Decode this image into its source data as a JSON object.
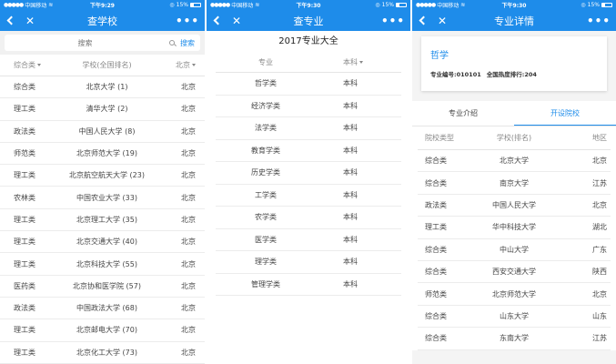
{
  "status": {
    "carrier": "中国移动",
    "time_left": "下午9:29",
    "time_mid": "下午9:30",
    "time_right": "下午9:30",
    "battery": "15%"
  },
  "screen1": {
    "title": "查学校",
    "search_placeholder": "搜索",
    "search_button": "搜索",
    "headers": {
      "type": "综合类",
      "school": "学校(全国排名)",
      "region": "北京"
    },
    "rows": [
      {
        "type": "综合类",
        "school": "北京大学 (1)",
        "region": "北京"
      },
      {
        "type": "理工类",
        "school": "清华大学 (2)",
        "region": "北京"
      },
      {
        "type": "政法类",
        "school": "中国人民大学 (8)",
        "region": "北京"
      },
      {
        "type": "师范类",
        "school": "北京师范大学 (19)",
        "region": "北京"
      },
      {
        "type": "理工类",
        "school": "北京航空航天大学 (23)",
        "region": "北京"
      },
      {
        "type": "农林类",
        "school": "中国农业大学 (33)",
        "region": "北京"
      },
      {
        "type": "理工类",
        "school": "北京理工大学 (35)",
        "region": "北京"
      },
      {
        "type": "理工类",
        "school": "北京交通大学 (40)",
        "region": "北京"
      },
      {
        "type": "理工类",
        "school": "北京科技大学 (55)",
        "region": "北京"
      },
      {
        "type": "医药类",
        "school": "北京协和医学院 (57)",
        "region": "北京"
      },
      {
        "type": "政法类",
        "school": "中国政法大学 (68)",
        "region": "北京"
      },
      {
        "type": "理工类",
        "school": "北京邮电大学 (70)",
        "region": "北京"
      },
      {
        "type": "理工类",
        "school": "北京化工大学 (73)",
        "region": "北京"
      }
    ]
  },
  "screen2": {
    "title": "查专业",
    "heading": "2017专业大全",
    "headers": {
      "major": "专业",
      "level": "本科"
    },
    "rows": [
      {
        "major": "哲学类",
        "level": "本科"
      },
      {
        "major": "经济学类",
        "level": "本科"
      },
      {
        "major": "法学类",
        "level": "本科"
      },
      {
        "major": "教育学类",
        "level": "本科"
      },
      {
        "major": "历史学类",
        "level": "本科"
      },
      {
        "major": "工学类",
        "level": "本科"
      },
      {
        "major": "农学类",
        "level": "本科"
      },
      {
        "major": "医学类",
        "level": "本科"
      },
      {
        "major": "理学类",
        "level": "本科"
      },
      {
        "major": "管理学类",
        "level": "本科"
      }
    ]
  },
  "screen3": {
    "title": "专业详情",
    "major_name": "哲学",
    "major_code": "专业编号:010101",
    "major_rank": "全国热度排行:204",
    "tabs": [
      {
        "label": "专业介绍",
        "active": false
      },
      {
        "label": "开设院校",
        "active": true
      }
    ],
    "headers": {
      "type": "院校类型",
      "school": "学校(排名)",
      "region": "地区"
    },
    "rows": [
      {
        "type": "综合类",
        "school": "北京大学",
        "region": "北京"
      },
      {
        "type": "综合类",
        "school": "南京大学",
        "region": "江苏"
      },
      {
        "type": "政法类",
        "school": "中国人民大学",
        "region": "北京"
      },
      {
        "type": "理工类",
        "school": "华中科技大学",
        "region": "湖北"
      },
      {
        "type": "综合类",
        "school": "中山大学",
        "region": "广东"
      },
      {
        "type": "综合类",
        "school": "西安交通大学",
        "region": "陕西"
      },
      {
        "type": "师范类",
        "school": "北京师范大学",
        "region": "北京"
      },
      {
        "type": "综合类",
        "school": "山东大学",
        "region": "山东"
      },
      {
        "type": "综合类",
        "school": "东南大学",
        "region": "江苏"
      }
    ]
  },
  "colors": {
    "accent": "#1e8cea"
  }
}
